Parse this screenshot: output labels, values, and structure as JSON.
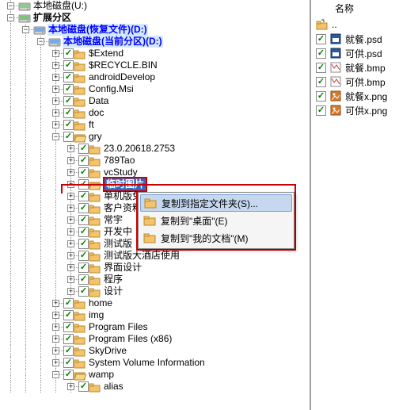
{
  "tree": {
    "root_partial": "本地磁盘(U:)",
    "ext_part": "扩展分区",
    "recover": "本地磁盘(恢复文件)(D:)",
    "current": "本地磁盘(当前分区)(D:)",
    "nodes": [
      "$Extend",
      "$RECYCLE.BIN",
      "androidDevelop",
      "Config.Msi",
      "Data",
      "doc",
      "ft",
      "gry"
    ],
    "gry_children": [
      "23.0.20618.2753",
      "789Tao",
      "vcStudy",
      "临时图片",
      "单机版免",
      "客户资料",
      "常宇",
      "开发中",
      "测试版",
      "测试版大酒店使用",
      "界面设计",
      "程序",
      "设计"
    ],
    "after_gry": [
      "home",
      "img",
      "Program Files",
      "Program Files (x86)",
      "SkyDrive",
      "System Volume Information",
      "wamp"
    ],
    "wamp_children": [
      "alias"
    ]
  },
  "ctx": {
    "copy_to_folder": "复制到指定文件夹(S)...",
    "copy_to_desktop": "复制到\"桌面\"(E)",
    "copy_to_docs": "复制到\"我的文档\"(M)"
  },
  "right": {
    "header_name": "名称",
    "files": [
      {
        "name": "就餐.psd",
        "ico": "psd"
      },
      {
        "name": "可供.psd",
        "ico": "psd"
      },
      {
        "name": "就餐.bmp",
        "ico": "bmp"
      },
      {
        "name": "可供.bmp",
        "ico": "bmp"
      },
      {
        "name": "就餐x.png",
        "ico": "png"
      },
      {
        "name": "可供x.png",
        "ico": "png"
      }
    ]
  }
}
